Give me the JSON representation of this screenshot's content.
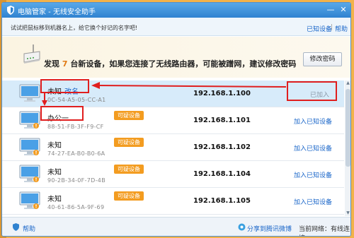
{
  "window": {
    "title": "电脑管家 - 无线安全助手",
    "minimize_glyph": "—",
    "close_glyph": "✕"
  },
  "toolbar": {
    "hint": "试试把鼠标移到机器名上，给它换个好记的名字吧!",
    "known_devices": "已知设备",
    "separator": "|",
    "help": "帮助"
  },
  "banner": {
    "prefix": "发现 ",
    "count": "7",
    "message": " 台新设备，如果您连接了无线路由器，可能被蹭网，建议修改密码",
    "change_password_button": "修改密码"
  },
  "devices": [
    {
      "name": "未知",
      "rename": "改名",
      "mac": "0C-54-A5-05-CC-A1",
      "ip": "192.168.1.100",
      "action": "已加入",
      "badge": ""
    },
    {
      "name": "办公一",
      "rename": "",
      "mac": "88-51-FB-3F-F9-CF",
      "ip": "192.168.1.101",
      "action": "加入已知设备",
      "badge": "可疑设备"
    },
    {
      "name": "未知",
      "rename": "",
      "mac": "74-27-EA-B0-B0-6A",
      "ip": "192.168.1.102",
      "action": "加入已知设备",
      "badge": "可疑设备"
    },
    {
      "name": "未知",
      "rename": "",
      "mac": "90-2B-34-0F-7D-4B",
      "ip": "192.168.1.104",
      "action": "加入已知设备",
      "badge": "可疑设备"
    },
    {
      "name": "未知",
      "rename": "",
      "mac": "40-61-86-5A-9F-69",
      "ip": "192.168.1.105",
      "action": "加入已知设备",
      "badge": "可疑设备"
    }
  ],
  "footer": {
    "help": "帮助",
    "share": "分享到腾讯微博",
    "current_network": "当前网络：有线连接"
  },
  "colors": {
    "accent": "#1a66c9",
    "badge": "#f39c20",
    "titlebar": "#2f82d0",
    "annotation": "#e01e1e"
  },
  "icons": [
    "shield-icon",
    "router-icon",
    "computer-icon",
    "warning-icon",
    "help-icon",
    "share-icon"
  ]
}
